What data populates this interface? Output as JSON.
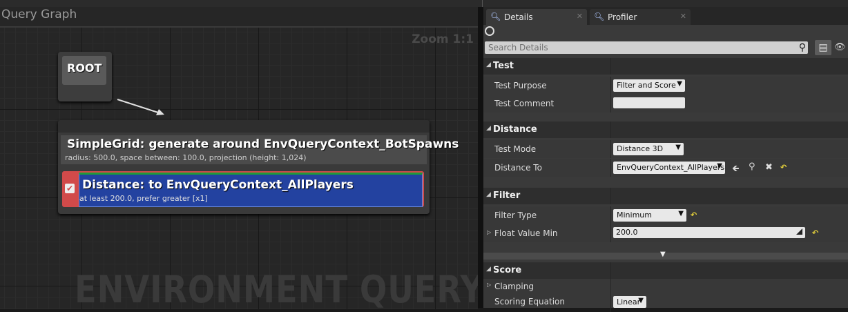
{
  "graph": {
    "title": "Query Graph",
    "zoom": "Zoom 1:1",
    "watermark": "ENVIRONMENT QUERY",
    "root_node": {
      "label": "ROOT"
    },
    "generator_node": {
      "title": "SimpleGrid: generate around EnvQueryContext_BotSpawns",
      "subtitle": "radius: 500.0, space between: 100.0, projection (height: 1,024)"
    },
    "test_node": {
      "enabled": true,
      "title": "Distance: to EnvQueryContext_AllPlayers",
      "subtitle": "at least 200.0, prefer greater [x1]"
    }
  },
  "tabs": [
    {
      "label": "Details",
      "icon": "magnifier-icon",
      "active": true
    },
    {
      "label": "Profiler",
      "icon": "magnifier-icon",
      "active": false
    }
  ],
  "details": {
    "search_placeholder": "Search Details",
    "categories": {
      "test": {
        "label": "Test"
      },
      "distance": {
        "label": "Distance"
      },
      "filter": {
        "label": "Filter"
      },
      "score": {
        "label": "Score"
      }
    },
    "props": {
      "test_purpose": {
        "label": "Test Purpose",
        "value": "Filter and Score"
      },
      "test_comment": {
        "label": "Test Comment",
        "value": ""
      },
      "test_mode": {
        "label": "Test Mode",
        "value": "Distance 3D"
      },
      "distance_to": {
        "label": "Distance To",
        "value": "EnvQueryContext_AllPlayers"
      },
      "filter_type": {
        "label": "Filter Type",
        "value": "Minimum"
      },
      "float_value_min": {
        "label": "Float Value Min",
        "value": "200.0"
      },
      "clamping": {
        "label": "Clamping"
      },
      "scoring_equation": {
        "label": "Scoring Equation",
        "value": "Linear"
      }
    }
  },
  "colors": {
    "test_node_accent": "#d14a4a",
    "test_box": "#2342a0",
    "reset_arrow": "#e6d23b"
  }
}
